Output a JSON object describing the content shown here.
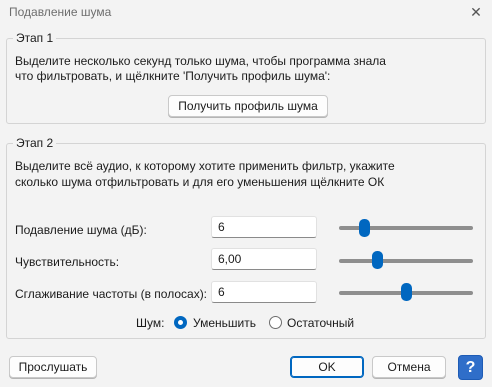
{
  "window": {
    "title": "Подавление шума",
    "close_glyph": "✕"
  },
  "step1": {
    "legend": "Этап 1",
    "line1": "Выделите несколько секунд только шума, чтобы программа знала",
    "line2": "что фильтровать, и щёлкните 'Получить профиль шума':",
    "button_label": "Получить профиль шума"
  },
  "step2": {
    "legend": "Этап 2",
    "line1": "Выделите всё аудио, к которому хотите применить фильтр, укажите",
    "line2": "сколько шума отфильтровать и для его уменьшения щёлкните ОК",
    "rows": [
      {
        "label": "Подавление шума (дБ):",
        "value": "6",
        "slider_fraction": 0.16
      },
      {
        "label": "Чувствительность:",
        "value": "6,00",
        "slider_fraction": 0.27
      },
      {
        "label": "Сглаживание частоты (в полосах):",
        "value": "6",
        "slider_fraction": 0.5
      }
    ],
    "noise_label": "Шум:",
    "radio_options": [
      {
        "label": "Уменьшить",
        "checked": true
      },
      {
        "label": "Остаточный",
        "checked": false
      }
    ]
  },
  "footer": {
    "preview_label": "Прослушать",
    "ok_label": "OK",
    "cancel_label": "Отмена",
    "help_glyph": "?"
  },
  "colors": {
    "accent": "#0067c0",
    "help": "#2f6ec9"
  }
}
